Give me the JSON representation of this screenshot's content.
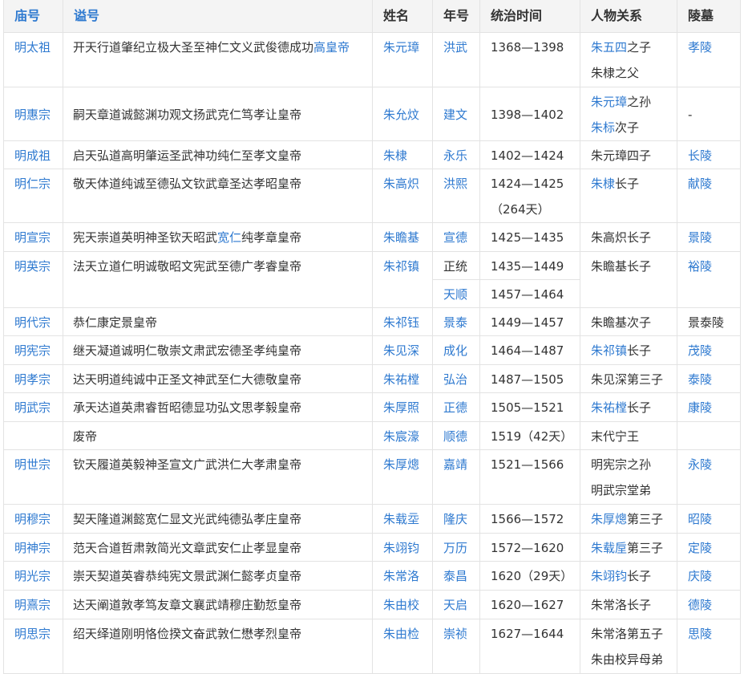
{
  "colors": {
    "link": "#2f7ad0",
    "text": "#333333",
    "header_bg": "#f4f4f4",
    "border": "#e3e3e3"
  },
  "headers": {
    "temple": "庙号",
    "posthumous": "谥号",
    "name": "姓名",
    "era": "年号",
    "reign": "统治时间",
    "relation": "人物关系",
    "tomb": "陵墓"
  },
  "rows": [
    {
      "temple": "明太祖",
      "post_a": "开天行道肇纪立极大圣至神仁文义武俊德成功",
      "post_b": "高皇帝",
      "name": "朱元璋",
      "era": "洪武",
      "reign": "1368—1398",
      "rel1_link": "朱五四",
      "rel1_text": "之子",
      "rel2": "朱棣之父",
      "tomb": "孝陵"
    },
    {
      "temple": "明惠宗",
      "post": "嗣天章道诚懿渊功观文扬武克仁笃孝让皇帝",
      "name": "朱允炆",
      "era": "建文",
      "reign": "1398—1402",
      "rel1_link": "朱元璋",
      "rel1_text": "之孙",
      "rel2_link": "朱标",
      "rel2_text": "次子",
      "tomb": "-"
    },
    {
      "temple": "明成祖",
      "post": "启天弘道高明肇运圣武神功纯仁至孝文皇帝",
      "name": "朱棣",
      "era": "永乐",
      "reign": "1402—1424",
      "rel": "朱元璋四子",
      "tomb": "长陵"
    },
    {
      "temple": "明仁宗",
      "post": "敬天体道纯诚至德弘文钦武章圣达孝昭皇帝",
      "name": "朱高炽",
      "era": "洪熙",
      "reign": "1424—1425",
      "reign2": "（264天）",
      "rel_link": "朱棣",
      "rel_text": "长子",
      "tomb": "献陵"
    },
    {
      "temple": "明宣宗",
      "post_a": "宪天崇道英明神圣钦天昭武",
      "post_b": "宽仁",
      "post_c": "纯孝章皇帝",
      "name": "朱瞻基",
      "era": "宣德",
      "reign": "1425—1435",
      "rel": "朱高炽长子",
      "tomb": "景陵"
    },
    {
      "temple": "明英宗",
      "post": "法天立道仁明诚敬昭文宪武至德广孝睿皇帝",
      "name": "朱祁镇",
      "era": "正统",
      "reign": "1435—1449",
      "era2": "天顺",
      "reign2": "1457—1464",
      "rel": "朱瞻基长子",
      "tomb": "裕陵"
    },
    {
      "temple": "明代宗",
      "post": "恭仁康定景皇帝",
      "name": "朱祁钰",
      "era": "景泰",
      "reign": "1449—1457",
      "rel": "朱瞻基次子",
      "tomb": "景泰陵"
    },
    {
      "temple": "明宪宗",
      "post": "继天凝道诚明仁敬崇文肃武宏德圣孝纯皇帝",
      "name": "朱见深",
      "era": "成化",
      "reign": "1464—1487",
      "rel_link": "朱祁镇",
      "rel_text": "长子",
      "tomb": "茂陵"
    },
    {
      "temple": "明孝宗",
      "post": "达天明道纯诚中正圣文神武至仁大德敬皇帝",
      "name": "朱祐樘",
      "era": "弘治",
      "reign": "1487—1505",
      "rel": "朱见深第三子",
      "tomb": "泰陵"
    },
    {
      "temple": "明武宗",
      "post": "承天达道英肃睿哲昭德显功弘文思孝毅皇帝",
      "name": "朱厚照",
      "era": "正德",
      "reign": "1505—1521",
      "rel_link": "朱祐樘",
      "rel_text": "长子",
      "tomb": "康陵"
    },
    {
      "temple": "",
      "post": "废帝",
      "name": "朱宸濠",
      "era": "顺德",
      "reign": "1519（42天）",
      "rel": "末代宁王",
      "tomb": ""
    },
    {
      "temple": "明世宗",
      "post": "钦天履道英毅神圣宣文广武洪仁大孝肃皇帝",
      "name": "朱厚熜",
      "era": "嘉靖",
      "reign": "1521—1566",
      "rel": "明宪宗之孙",
      "rel2": "明武宗堂弟",
      "tomb": "永陵"
    },
    {
      "temple": "明穆宗",
      "post": "契天隆道渊懿宽仁显文光武纯德弘孝庄皇帝",
      "name": "朱载坖",
      "era": "隆庆",
      "reign": "1566—1572",
      "rel_link": "朱厚熜",
      "rel_text": "第三子",
      "tomb": "昭陵"
    },
    {
      "temple": "明神宗",
      "post": "范天合道哲肃敦简光文章武安仁止孝显皇帝",
      "name": "朱翊钧",
      "era": "万历",
      "reign": "1572—1620",
      "rel_link": "朱载垕",
      "rel_text": "第三子",
      "tomb": "定陵"
    },
    {
      "temple": "明光宗",
      "post": "崇天契道英睿恭纯宪文景武渊仁懿孝贞皇帝",
      "name": "朱常洛",
      "era": "泰昌",
      "reign": "1620（29天）",
      "rel_link": "朱翊钧",
      "rel_text": "长子",
      "tomb": "庆陵"
    },
    {
      "temple": "明熹宗",
      "post": "达天阐道敦孝笃友章文襄武靖穆庄勤悊皇帝",
      "name": "朱由校",
      "era": "天启",
      "reign": "1620—1627",
      "rel": "朱常洛长子",
      "tomb": "德陵"
    },
    {
      "temple": "明思宗",
      "post": "绍天绎道刚明恪俭揆文奋武敦仁懋孝烈皇帝",
      "name": "朱由检",
      "era": "崇祯",
      "reign": "1627—1644",
      "rel": "朱常洛第五子",
      "rel2": "朱由校异母弟",
      "tomb": "思陵"
    }
  ]
}
